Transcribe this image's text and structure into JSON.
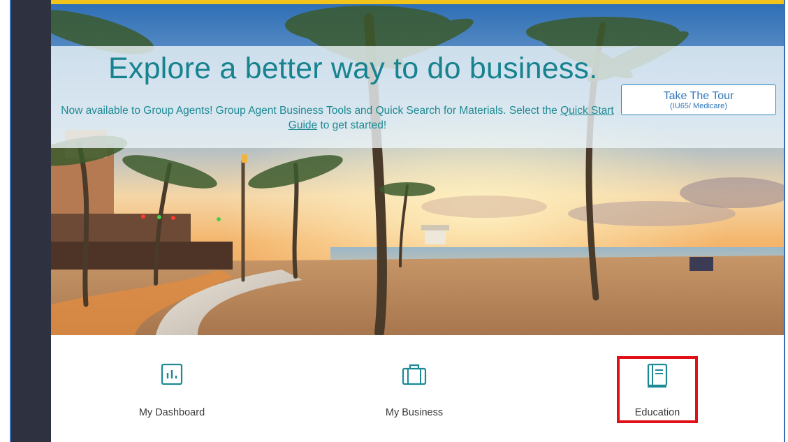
{
  "hero": {
    "headline": "Explore a better way to do business.",
    "subtext_before": "Now available to Group Agents! Group Agent Business Tools and Quick Search for Materials. Select the ",
    "subtext_link": "Quick Start Guide",
    "subtext_after": " to get started!",
    "tour_button": {
      "title": "Take The Tour",
      "subtitle": "(IU65/ Medicare)"
    }
  },
  "tiles": [
    {
      "label": "My Dashboard",
      "icon": "bar-chart-icon"
    },
    {
      "label": "My Business",
      "icon": "briefcase-icon"
    },
    {
      "label": "Education",
      "icon": "book-icon"
    }
  ],
  "colors": {
    "accent_teal": "#17838f",
    "icon_teal": "#1d8a93",
    "top_stripe": "#f2c31b",
    "highlight_red": "#e10f17",
    "rail_dark": "#2d3140",
    "button_blue": "#2f75b8"
  }
}
